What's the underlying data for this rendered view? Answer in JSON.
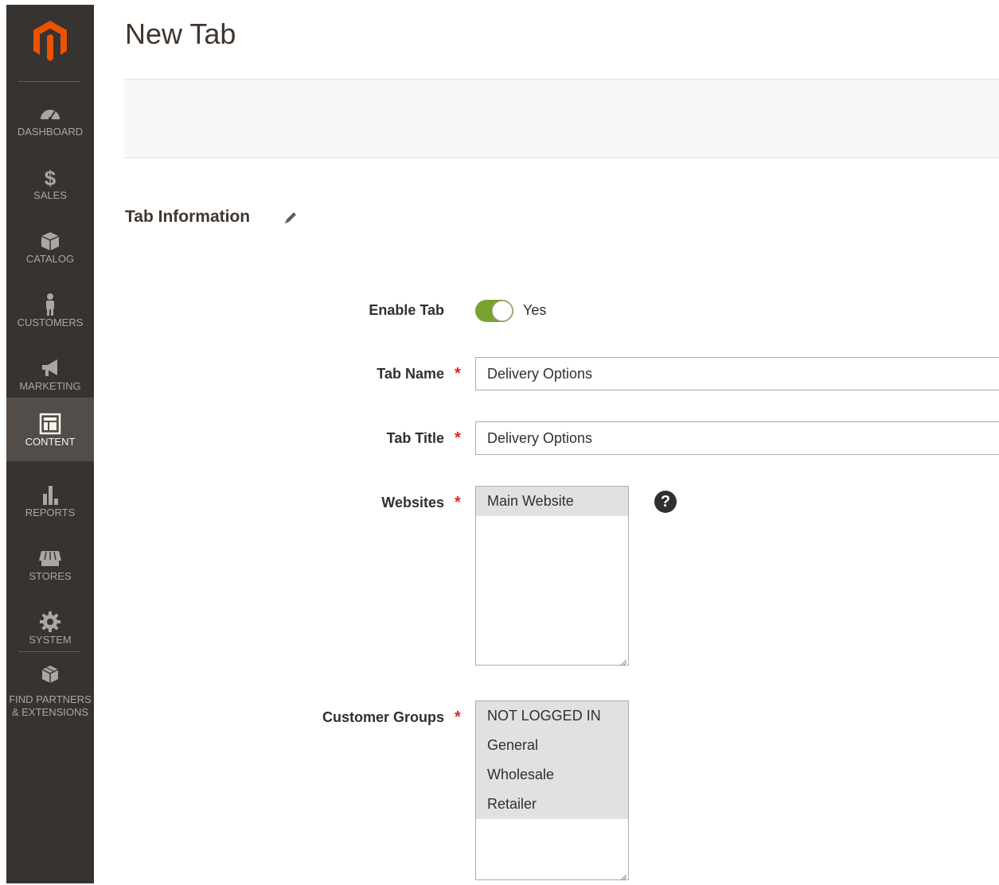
{
  "page": {
    "title": "New Tab"
  },
  "sidebar": {
    "items": [
      {
        "label": "DASHBOARD",
        "icon": "dashboard-icon"
      },
      {
        "label": "SALES",
        "icon": "dollar-icon"
      },
      {
        "label": "CATALOG",
        "icon": "box-icon"
      },
      {
        "label": "CUSTOMERS",
        "icon": "person-icon"
      },
      {
        "label": "MARKETING",
        "icon": "megaphone-icon"
      },
      {
        "label": "CONTENT",
        "icon": "layout-icon",
        "active": true
      },
      {
        "label": "REPORTS",
        "icon": "bar-chart-icon"
      },
      {
        "label": "STORES",
        "icon": "store-icon"
      },
      {
        "label": "SYSTEM",
        "icon": "gear-icon"
      }
    ],
    "partners": {
      "line1": "FIND PARTNERS",
      "line2": "& EXTENSIONS",
      "icon": "cubes-icon"
    }
  },
  "section": {
    "title": "Tab Information",
    "edit_icon": "pencil-icon"
  },
  "form": {
    "enable_tab": {
      "label": "Enable Tab",
      "state": "Yes",
      "on": true
    },
    "tab_name": {
      "label": "Tab Name",
      "value": "Delivery Options",
      "required_mark": "*"
    },
    "tab_title": {
      "label": "Tab Title",
      "value": "Delivery Options",
      "required_mark": "*"
    },
    "websites": {
      "label": "Websites",
      "required_mark": "*",
      "options": [
        "Main Website"
      ],
      "help": "?"
    },
    "customer_groups": {
      "label": "Customer Groups",
      "required_mark": "*",
      "options": [
        "NOT LOGGED IN",
        "General",
        "Wholesale",
        "Retailer"
      ]
    }
  },
  "colors": {
    "accent": "#eb5202",
    "toggle_on": "#79a22e",
    "required": "#e22626",
    "sidebar": "#373330"
  }
}
